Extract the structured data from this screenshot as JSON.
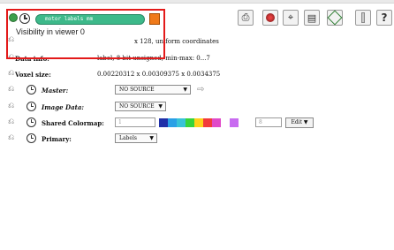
{
  "header": {
    "object_name": "motor labels mm",
    "tooltip": "Visibility in viewer 0",
    "swatch_color": "#f07a1a"
  },
  "toolbar": {
    "icons": [
      "save-icon",
      "material-icon",
      "crop-icon",
      "list-icon",
      "bounding-box-icon",
      "slider-icon",
      "help-icon"
    ],
    "help_label": "?"
  },
  "info": {
    "dims_partial": "x 128, uniform coordinates",
    "data_info_label": "Data info:",
    "data_info_value": "label, 8-bit unsigned, min-max: 0...7",
    "voxel_size_label": "Voxel size:",
    "voxel_size_value": "0.00220312 x 0.00309375 x 0.0034375"
  },
  "ports": {
    "master_label": "Master:",
    "master_value": "NO SOURCE",
    "image_data_label": "Image Data:",
    "image_data_value": "NO SOURCE",
    "shared_colormap_label": "Shared Colormap:",
    "colormap_min": "1",
    "colormap_max": "8",
    "colormap_colors": [
      "#1f2fa8",
      "#2aa0e6",
      "#38c3d8",
      "#37d43b",
      "#ffd11a",
      "#f23a3a",
      "#e04ac8",
      "#ffffff",
      "#c86bf0"
    ],
    "edit_label": "Edit",
    "primary_label": "Primary:",
    "primary_value": "Labels"
  }
}
